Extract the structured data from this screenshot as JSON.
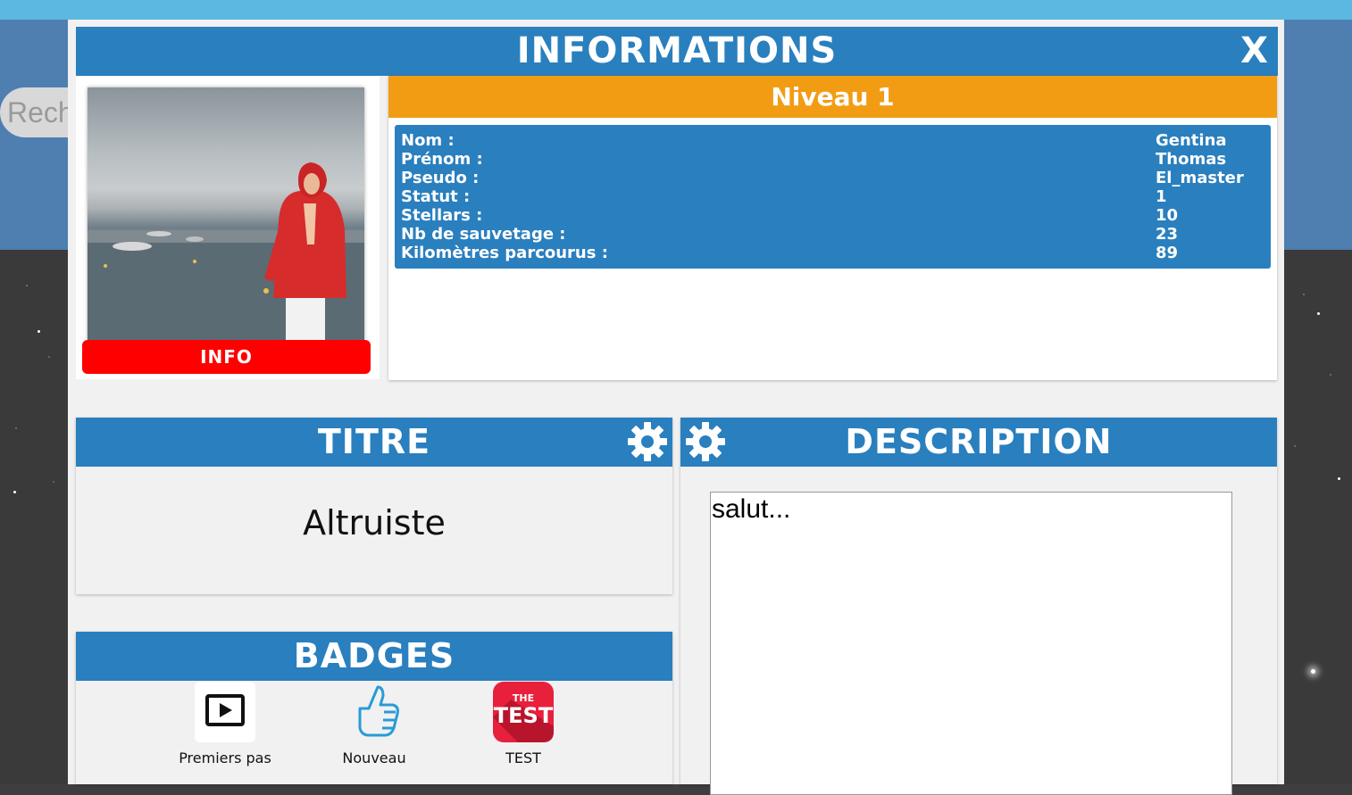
{
  "background": {
    "search_text": "Rech"
  },
  "modal": {
    "title": "INFORMATIONS",
    "close_label": "X"
  },
  "profile": {
    "info_button_label": "INFO",
    "level_label": "Niveau 1",
    "stats": [
      {
        "label": "Nom :",
        "value": "Gentina"
      },
      {
        "label": "Prénom :",
        "value": "Thomas"
      },
      {
        "label": "Pseudo :",
        "value": "El_master"
      },
      {
        "label": "Statut :",
        "value": "1"
      },
      {
        "label": "Stellars :",
        "value": "10"
      },
      {
        "label": "Nb de sauvetage :",
        "value": "23"
      },
      {
        "label": "Kilomètres parcourus :",
        "value": "89"
      }
    ]
  },
  "titre": {
    "header": "TITRE",
    "value": "Altruiste"
  },
  "badges": {
    "header": "BADGES",
    "items": [
      {
        "label": "Premiers pas",
        "icon": "play-icon"
      },
      {
        "label": "Nouveau",
        "icon": "thumbs-up-icon"
      },
      {
        "label": "TEST",
        "icon": "the-test-app-icon",
        "icon_text_top": "THE",
        "icon_text_main": "TEST"
      }
    ]
  },
  "description": {
    "header": "DESCRIPTION",
    "text": "salut..."
  },
  "colors": {
    "header_blue": "#2a7fbe",
    "level_orange": "#f29c14",
    "info_red": "#ff0000",
    "badge_red": "#e8203c"
  }
}
